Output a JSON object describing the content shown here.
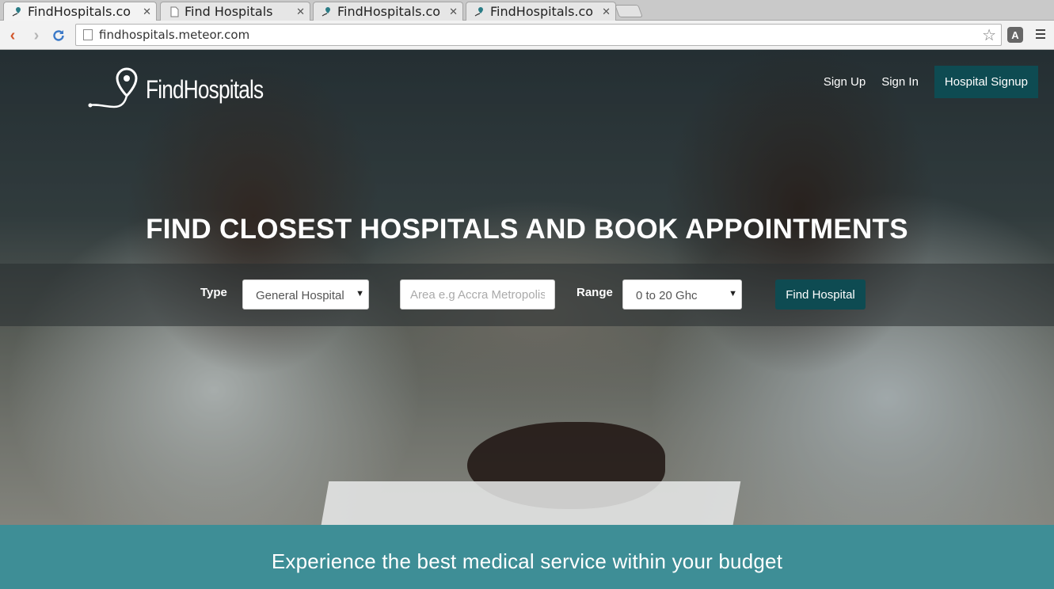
{
  "browser": {
    "tabs": [
      {
        "title": "FindHospitals.co",
        "active": true
      },
      {
        "title": "Find Hospitals",
        "active": false
      },
      {
        "title": "FindHospitals.co",
        "active": false
      },
      {
        "title": "FindHospitals.co",
        "active": false
      }
    ],
    "url": "findhospitals.meteor.com",
    "extension_label": "A"
  },
  "header": {
    "brand": "FindHospitals",
    "nav": {
      "sign_up": "Sign Up",
      "sign_in": "Sign In",
      "hospital_signup": "Hospital Signup"
    }
  },
  "hero": {
    "headline": "FIND CLOSEST HOSPITALS AND BOOK APPOINTMENTS"
  },
  "search": {
    "type_label": "Type",
    "type_value": "General Hospital",
    "area_placeholder": "Area e.g Accra Metropolis",
    "range_label": "Range",
    "range_value": "0 to 20 Ghc",
    "submit_label": "Find Hospital"
  },
  "banner": {
    "tagline": "Experience the best medical service within your budget"
  },
  "colors": {
    "accent": "#0e4b52",
    "banner": "#3e8e96"
  }
}
